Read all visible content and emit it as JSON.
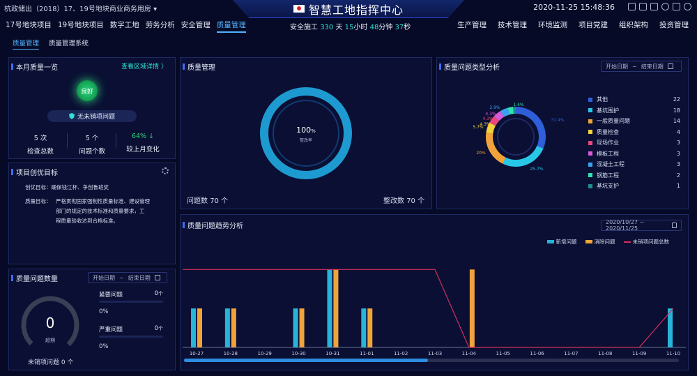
{
  "header": {
    "project": "杭政储出（2018）17、19号地块商业商务用房",
    "title": "智慧工地指挥中心",
    "datetime": "2020-11-25 15:48:36"
  },
  "nav_left": [
    "17号地块项目",
    "19号地块项目",
    "数字工地",
    "劳务分析",
    "安全管理",
    "质量管理"
  ],
  "active_nav": "质量管理",
  "nav_right": [
    "生产管理",
    "技术管理",
    "环境监测",
    "项目党建",
    "组织架构",
    "投资管理"
  ],
  "safety": {
    "prefix": "安全施工",
    "days": "330",
    "days_unit": "天",
    "hours": "15",
    "hours_unit": "小时",
    "minutes": "48",
    "minutes_unit": "分钟",
    "seconds": "37",
    "seconds_unit": "秒"
  },
  "subtabs": [
    "质量管理",
    "质量管理系统"
  ],
  "monthly": {
    "title": "本月质量一览",
    "link": "查看区域详情 〉",
    "status": "良好",
    "no_issue": "无未销项问题",
    "stats": [
      {
        "value": "5 次",
        "label": "检查总数"
      },
      {
        "value": "5 个",
        "label": "问题个数"
      },
      {
        "value": "64% ↓",
        "label": "较上月变化"
      }
    ]
  },
  "goals": {
    "title": "项目创优目标",
    "target_label": "创优目标：",
    "target": "确保钱江杯、争创鲁班奖",
    "quality_label": "质量目标：",
    "quality": [
      "严格贯彻国家强制性质量标准、建设管理",
      "部门的规定的技术标准和质量要求，工",
      "程质量验收达到合格标准。"
    ]
  },
  "problem_count": {
    "title": "质量问题数量",
    "start": "开始日期",
    "sep": "~",
    "end": "结束日期",
    "gauge_value": "0",
    "gauge_label": "超期",
    "unsold_label": "未销项问题",
    "unsold_value": "0 个",
    "rows": [
      {
        "label": "紧要问题",
        "count": "0",
        "unit": "个",
        "pct": "0%"
      },
      {
        "label": "严重问题",
        "count": "0",
        "unit": "个",
        "pct": "0%"
      }
    ]
  },
  "qm": {
    "title": "质量管理",
    "pct": "100",
    "pct_unit": "%",
    "sub": "整改率",
    "issue_label": "问题数",
    "issue_value": "70",
    "fix_label": "整改数",
    "fix_value": "70",
    "unit": "个"
  },
  "types": {
    "title": "质量问题类型分析",
    "start": "开始日期",
    "sep": "~",
    "end": "结束日期",
    "callouts": [
      "1.4%",
      "2.9%",
      "4.3%",
      "4.3%",
      "4.3%",
      "5.7%",
      "20%",
      "31.4%",
      "25.7%"
    ],
    "items": [
      {
        "name": "其他",
        "value": 22,
        "color": "#2e5fd8"
      },
      {
        "name": "基坑围护",
        "value": 18,
        "color": "#28c7e8"
      },
      {
        "name": "一般质量问题",
        "value": 14,
        "color": "#f0a33a"
      },
      {
        "name": "质量检查",
        "value": 4,
        "color": "#f2d23a"
      },
      {
        "name": "现场作业",
        "value": 3,
        "color": "#e7477a"
      },
      {
        "name": "模板工程",
        "value": 3,
        "color": "#d85ad8"
      },
      {
        "name": "混凝土工程",
        "value": 3,
        "color": "#3ba0f0"
      },
      {
        "name": "钢筋工程",
        "value": 2,
        "color": "#2ee3b0"
      },
      {
        "name": "基坑支护",
        "value": 1,
        "color": "#1f8f8a"
      }
    ]
  },
  "trend": {
    "title": "质量问题趋势分析",
    "range": "2020/10/27 ~ 2020/11/25",
    "legend": [
      "新增问题",
      "消除问题",
      "未销项问题总数"
    ]
  },
  "chart_data": {
    "type": "bar",
    "categories": [
      "10-27",
      "10-28",
      "10-29",
      "10-30",
      "10-31",
      "11-01",
      "11-02",
      "11-03",
      "11-04",
      "11-05",
      "11-06",
      "11-07",
      "11-08",
      "11-09",
      "11-10"
    ],
    "series": [
      {
        "name": "新增问题",
        "type": "bar",
        "color": "#28b3d8",
        "values": [
          1,
          1,
          0,
          1,
          2,
          1,
          0,
          0,
          0,
          0,
          0,
          0,
          0,
          0,
          1
        ]
      },
      {
        "name": "消除问题",
        "type": "bar",
        "color": "#f0a33a",
        "values": [
          1,
          1,
          0,
          1,
          2,
          1,
          0,
          0,
          2,
          0,
          0,
          0,
          0,
          0,
          0
        ]
      },
      {
        "name": "未销项问题总数",
        "type": "line",
        "color": "#d0315d",
        "values": [
          2,
          2,
          2,
          2,
          2,
          2,
          2,
          2,
          0,
          0,
          0,
          0,
          0,
          0,
          1
        ]
      }
    ],
    "ylim": [
      0,
      2.4
    ]
  }
}
